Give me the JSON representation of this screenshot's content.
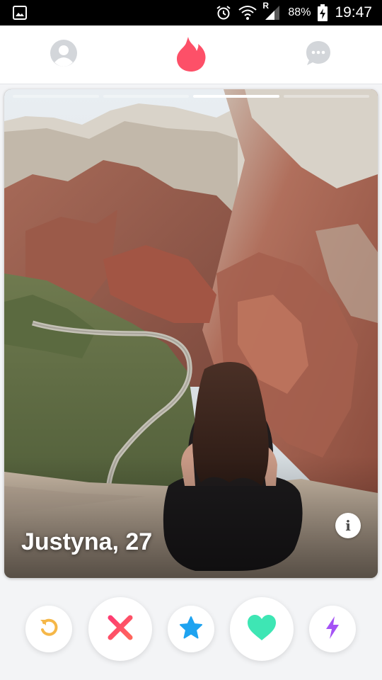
{
  "status_bar": {
    "icons": [
      "image-icon",
      "alarm-icon",
      "wifi-icon",
      "signal-icon",
      "battery-charging-icon"
    ],
    "roaming_label": "R",
    "battery_percent": "88%",
    "time": "19:47"
  },
  "top_nav": {
    "icons": [
      "profile-icon",
      "flame-logo-icon",
      "chat-icon"
    ],
    "colors": {
      "inactive": "#d3d6da",
      "brand": "#fd5068"
    }
  },
  "card": {
    "name_age": "Justyna, 27",
    "photo_count": 4,
    "active_photo_index": 2,
    "info_glyph": "i"
  },
  "actions": {
    "buttons": [
      {
        "icon": "rewind-icon",
        "color": "#f5b748"
      },
      {
        "icon": "nope-icon",
        "color": "#fd5068"
      },
      {
        "icon": "super-like-icon",
        "color": "#1ea3f0"
      },
      {
        "icon": "like-icon",
        "color": "#3ee6b4"
      },
      {
        "icon": "boost-icon",
        "color": "#a553f5"
      }
    ]
  }
}
